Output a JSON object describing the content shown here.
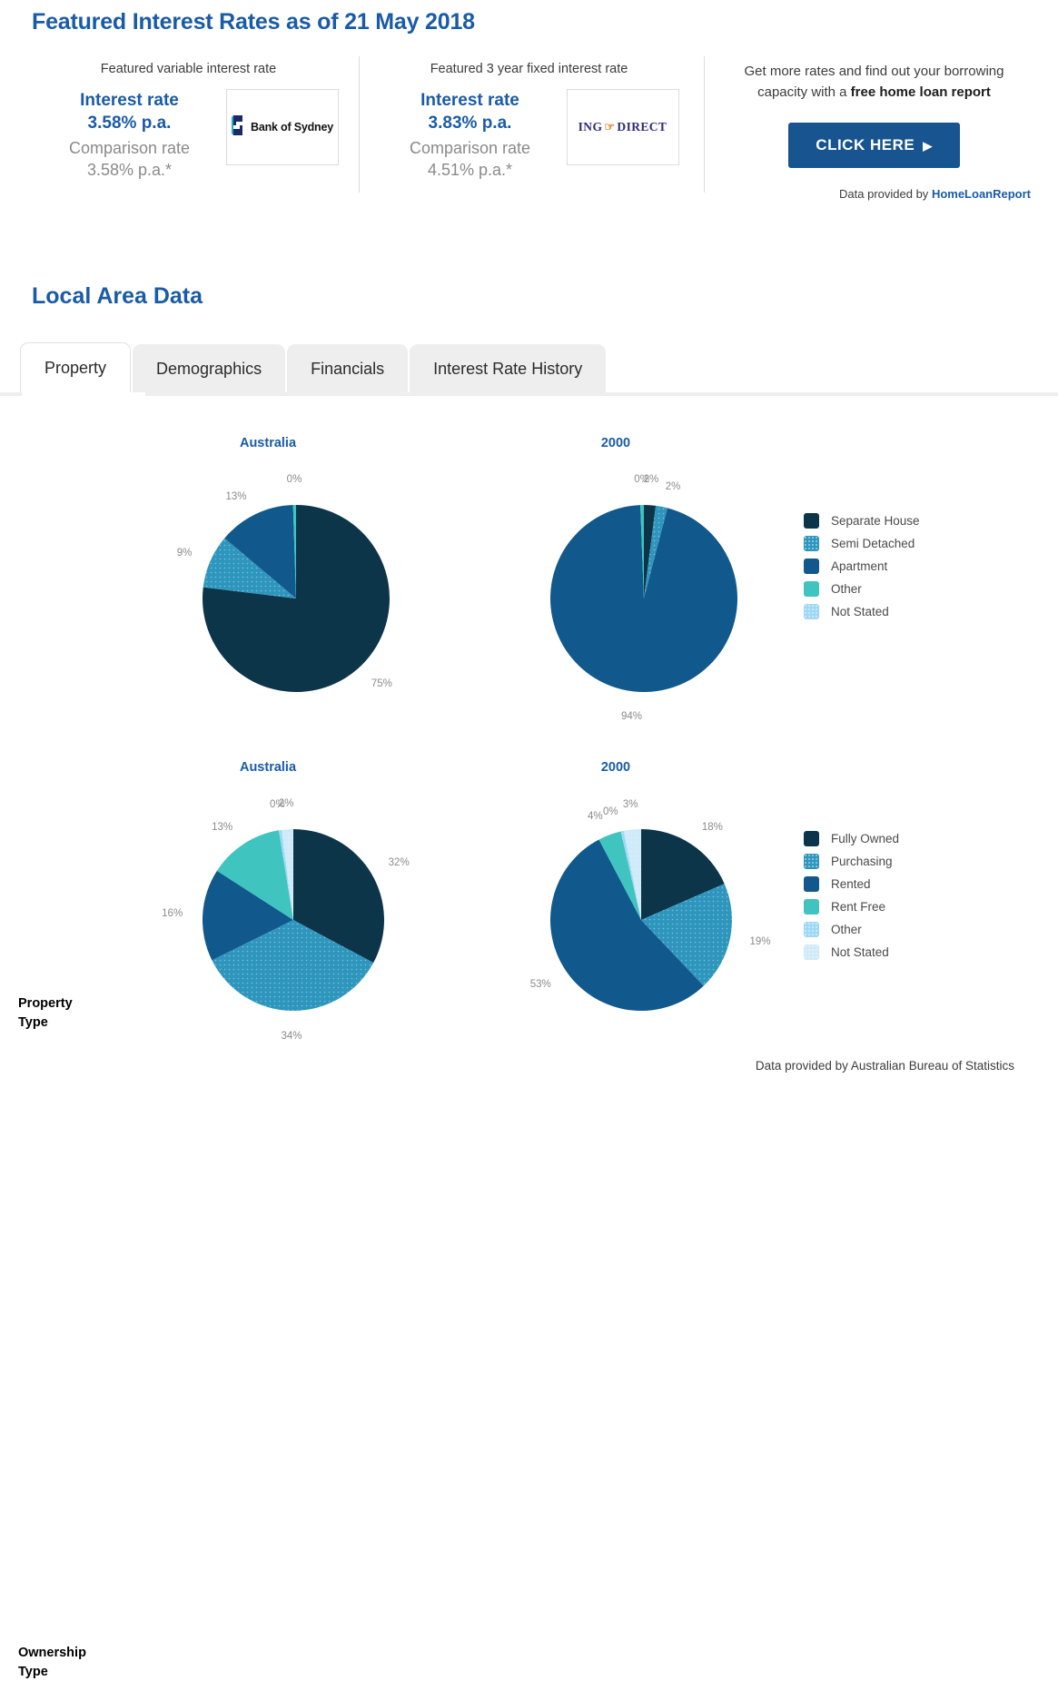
{
  "header": {
    "title": "Featured Interest Rates as of 21 May 2018",
    "rates": [
      {
        "caption": "Featured variable interest rate",
        "rate_label": "Interest rate",
        "rate_value": "3.58% p.a.",
        "comparison_label": "Comparison rate",
        "comparison_value": "3.58% p.a.*",
        "logo_name": "bank-of-sydney-logo",
        "logo_text": "Bank of Sydney"
      },
      {
        "caption": "Featured 3 year fixed interest rate",
        "rate_label": "Interest rate",
        "rate_value": "3.83% p.a.",
        "comparison_label": "Comparison rate",
        "comparison_value": "4.51% p.a.*",
        "logo_name": "ing-direct-logo",
        "logo_text_1": "ING",
        "logo_text_2": "DIRECT"
      }
    ],
    "promo": {
      "line1": "Get more rates and find out your borrowing",
      "line2_prefix": "capacity with a ",
      "line2_bold": "free home loan report",
      "cta_label": "CLICK HERE",
      "cta_arrow": "▶",
      "credit_prefix": "Data provided by ",
      "credit_link": "HomeLoanReport"
    }
  },
  "local_area": {
    "section_title": "Local Area Data",
    "tabs": [
      {
        "label": "Property",
        "active": true
      },
      {
        "label": "Demographics",
        "active": false
      },
      {
        "label": "Financials",
        "active": false
      },
      {
        "label": "Interest Rate History",
        "active": false
      }
    ],
    "row_labels": {
      "property": [
        "Property",
        "Type"
      ],
      "ownership": [
        "Ownership",
        "Type"
      ]
    },
    "footer_credit": "Data provided by Australian Bureau of Statistics"
  },
  "colors": {
    "brand_blue": "#1a5ba6",
    "cta_blue": "#18548f",
    "navy": "#0d3549",
    "cyan": "#2e96bd",
    "medium_blue": "#11588c",
    "teal": "#3fc4c0",
    "light_blue": "#9ed8f5",
    "pale_blue": "#cfeaf8",
    "label_grey": "#8b8b8b"
  },
  "chart_data": [
    {
      "type": "pie",
      "title": "Australia",
      "group": "Property Type",
      "categories": [
        "Separate House",
        "Semi Detached",
        "Apartment",
        "Other",
        "Not Stated"
      ],
      "values": [
        75,
        9,
        13,
        0.5,
        0
      ],
      "labels": [
        "75%",
        "9%",
        "13%",
        "0%",
        ""
      ],
      "colors": [
        "#0d3549",
        "#2e96bd",
        "#11588c",
        "#3fc4c0",
        "#9ed8f5"
      ],
      "legend_position": "right",
      "start_angle": 0,
      "direction": "clockwise"
    },
    {
      "type": "pie",
      "title": "2000",
      "group": "Property Type",
      "categories": [
        "Separate House",
        "Semi Detached",
        "Apartment",
        "Other",
        "Not Stated"
      ],
      "values": [
        2,
        2,
        94,
        0.6,
        0
      ],
      "labels": [
        "2%",
        "2%",
        "94%",
        "0%",
        ""
      ],
      "colors": [
        "#0d3549",
        "#2e96bd",
        "#11588c",
        "#3fc4c0",
        "#9ed8f5"
      ],
      "legend_position": "right",
      "start_angle": 0,
      "direction": "clockwise"
    },
    {
      "type": "pie",
      "title": "Australia",
      "group": "Ownership Type",
      "categories": [
        "Fully Owned",
        "Purchasing",
        "Rented",
        "Rent Free",
        "Other",
        "Not Stated"
      ],
      "values": [
        32,
        34,
        16,
        13,
        0.5,
        2
      ],
      "labels": [
        "32%",
        "34%",
        "16%",
        "13%",
        "0%",
        "2%"
      ],
      "colors": [
        "#0d3549",
        "#2e96bd",
        "#11588c",
        "#3fc4c0",
        "#9ed8f5",
        "#cfeaf8"
      ],
      "legend_position": "right",
      "start_angle": 0,
      "direction": "clockwise"
    },
    {
      "type": "pie",
      "title": "2000",
      "group": "Ownership Type",
      "categories": [
        "Fully Owned",
        "Purchasing",
        "Rented",
        "Rent Free",
        "Other",
        "Not Stated"
      ],
      "values": [
        18,
        19,
        53,
        4,
        0.5,
        3
      ],
      "labels": [
        "18%",
        "19%",
        "53%",
        "4%",
        "0%",
        "3%"
      ],
      "colors": [
        "#0d3549",
        "#2e96bd",
        "#11588c",
        "#3fc4c0",
        "#9ed8f5",
        "#cfeaf8"
      ],
      "legend_position": "right",
      "start_angle": 0,
      "direction": "clockwise"
    }
  ],
  "legends": [
    {
      "name": "property-type-legend",
      "items": [
        {
          "label": "Separate House",
          "color": "#0d3549",
          "pattern": "solid"
        },
        {
          "label": "Semi Detached",
          "color": "#2e96bd",
          "pattern": "dots"
        },
        {
          "label": "Apartment",
          "color": "#11588c",
          "pattern": "solid"
        },
        {
          "label": "Other",
          "color": "#3fc4c0",
          "pattern": "solid"
        },
        {
          "label": "Not Stated",
          "color": "#9ed8f5",
          "pattern": "dots"
        }
      ]
    },
    {
      "name": "ownership-type-legend",
      "items": [
        {
          "label": "Fully Owned",
          "color": "#0d3549",
          "pattern": "solid"
        },
        {
          "label": "Purchasing",
          "color": "#2e96bd",
          "pattern": "dots"
        },
        {
          "label": "Rented",
          "color": "#11588c",
          "pattern": "solid"
        },
        {
          "label": "Rent Free",
          "color": "#3fc4c0",
          "pattern": "solid"
        },
        {
          "label": "Other",
          "color": "#9ed8f5",
          "pattern": "dots"
        },
        {
          "label": "Not Stated",
          "color": "#cfeaf8",
          "pattern": "dots"
        }
      ]
    }
  ]
}
